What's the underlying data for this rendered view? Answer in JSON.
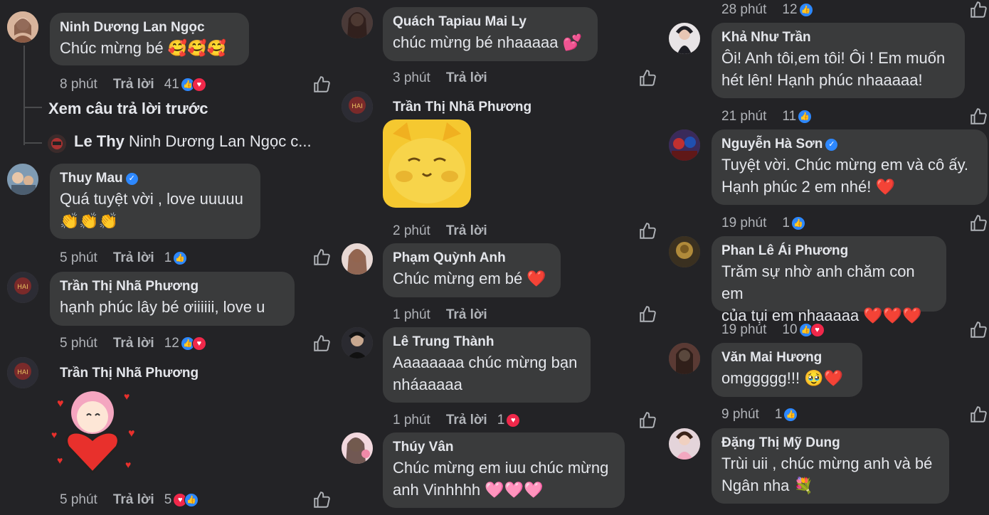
{
  "thread_nav": {
    "prev_replies": "Xem câu trả lời trước",
    "reply_preview_author": "Le Thy",
    "reply_preview_text": "Ninh Dương Lan Ngọc c..."
  },
  "reply_label": "Trả lời",
  "colors": {
    "bg": "#232326",
    "bubble": "#3a3b3c",
    "meta": "#b0b3b8",
    "like": "#2d88ff",
    "love": "#f0284a"
  },
  "comments": [
    {
      "name": "Ninh Dương Lan Ngọc",
      "text": "Chúc mừng bé 🥰🥰🥰",
      "time": "8 phút",
      "count": "41",
      "verified": false
    },
    {
      "name": "Thuy Mau",
      "text": "Quá tuyệt vời , love uuuuu",
      "text2": "👏👏👏",
      "time": "5 phút",
      "count": "1",
      "verified": true
    },
    {
      "name": "Trần Thị Nhã Phương",
      "text": "hạnh phúc lây bé ơiiiiii,  love u",
      "time": "5 phút",
      "count": "12",
      "verified": false
    },
    {
      "name": "Trần Thị Nhã Phương",
      "text": "",
      "time": "5 phút",
      "count": "5",
      "verified": false,
      "sticker": "girl-heart-sticker"
    },
    {
      "name": "Quách Tapiau Mai Ly",
      "text": "chúc mừng bé nhaaaaa 💕",
      "time": "3 phút",
      "count": "",
      "verified": false
    },
    {
      "name": "Trần Thị Nhã Phương",
      "text": "",
      "time": "2 phút",
      "count": "",
      "verified": false,
      "sticker": "yellow-cat-sticker"
    },
    {
      "name": "Phạm Quỳnh Anh",
      "text": "Chúc mừng em bé ❤️",
      "time": "1 phút",
      "count": "",
      "verified": false
    },
    {
      "name": "Lê Trung Thành",
      "text": "Aaaaaaaa chúc mừng bạn",
      "text2": "nháaaaaa",
      "time": "1 phút",
      "count": "1",
      "verified": false
    },
    {
      "name": "Thúy Vân",
      "text": "Chúc mừng em iuu chúc mừng",
      "text2": "anh Vinhhhh 🩷🩷🩷",
      "time": "",
      "count": "",
      "verified": false
    },
    {
      "name": "",
      "text": "",
      "time": "28 phút",
      "count": "12",
      "verified": false
    },
    {
      "name": "Khả Như Trần",
      "text": "Ôi! Anh tôi,em tôi! Ôi ! Em muốn",
      "text2": "hét lên! Hạnh phúc nhaaaaa!",
      "time": "21 phút",
      "count": "11",
      "verified": false
    },
    {
      "name": "Nguyễn Hà Sơn",
      "text": "Tuyệt vời. Chúc mừng em và cô ấy.",
      "text2": "Hạnh phúc 2 em nhé! ❤️",
      "time": "19 phút",
      "count": "1",
      "verified": true
    },
    {
      "name": "Phan Lê Ái Phương",
      "text": "Trăm sự nhờ anh chăm con em",
      "text2": "của tụi em nhaaaaa ❤️❤️❤️",
      "time": "19 phút",
      "count": "10",
      "verified": false
    },
    {
      "name": "Văn Mai Hương",
      "text": "omggggg!!! 🥹❤️",
      "time": "9 phút",
      "count": "1",
      "verified": false
    },
    {
      "name": "Đặng Thị Mỹ Dung",
      "text": "Trùi uii , chúc mừng anh và bé",
      "text2": "Ngân nha 💐",
      "time": "",
      "count": "",
      "verified": false
    }
  ]
}
